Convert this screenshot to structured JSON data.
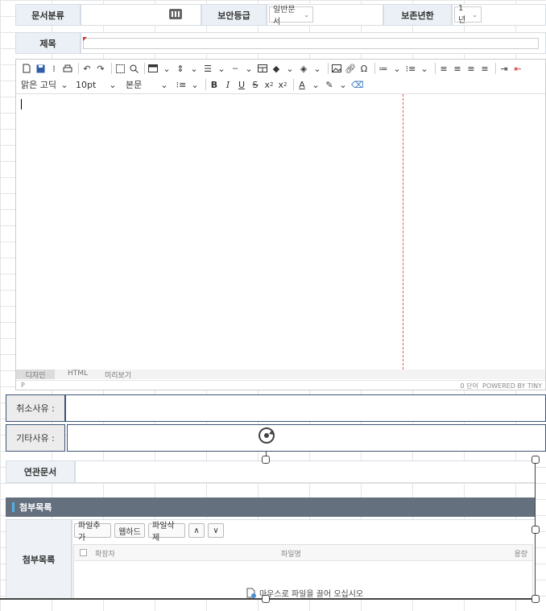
{
  "header": {
    "doc_class_label": "문서분류",
    "doc_class_icon": "grid-icon",
    "security_label": "보안등급",
    "security_value": "일반문서",
    "retention_label": "보존년한",
    "retention_value": "1년"
  },
  "title_row": {
    "label": "제목",
    "value": ""
  },
  "editor": {
    "font_family": "맑은 고딕",
    "font_size": "10pt",
    "block_format": "본문",
    "modes": [
      "디자인",
      "HTML",
      "미리보기"
    ],
    "status_path": "P",
    "word_count": "0 단어",
    "powered_by": "POWERED BY TINY"
  },
  "reasons": {
    "cancel_label": "취소사유 :",
    "other_label": "기타사유 :"
  },
  "related": {
    "label": "연관문서"
  },
  "attachments": {
    "section_title": "첨부목록",
    "row_label": "첨부목록",
    "buttons": [
      "파일추가",
      "웹하드",
      "파일삭제"
    ],
    "up": "∧",
    "down": "∨",
    "col_ext": "확장자",
    "col_name": "파일명",
    "col_size": "용량",
    "drop_hint": "마우스로 파일을 끌어 오십시오"
  }
}
